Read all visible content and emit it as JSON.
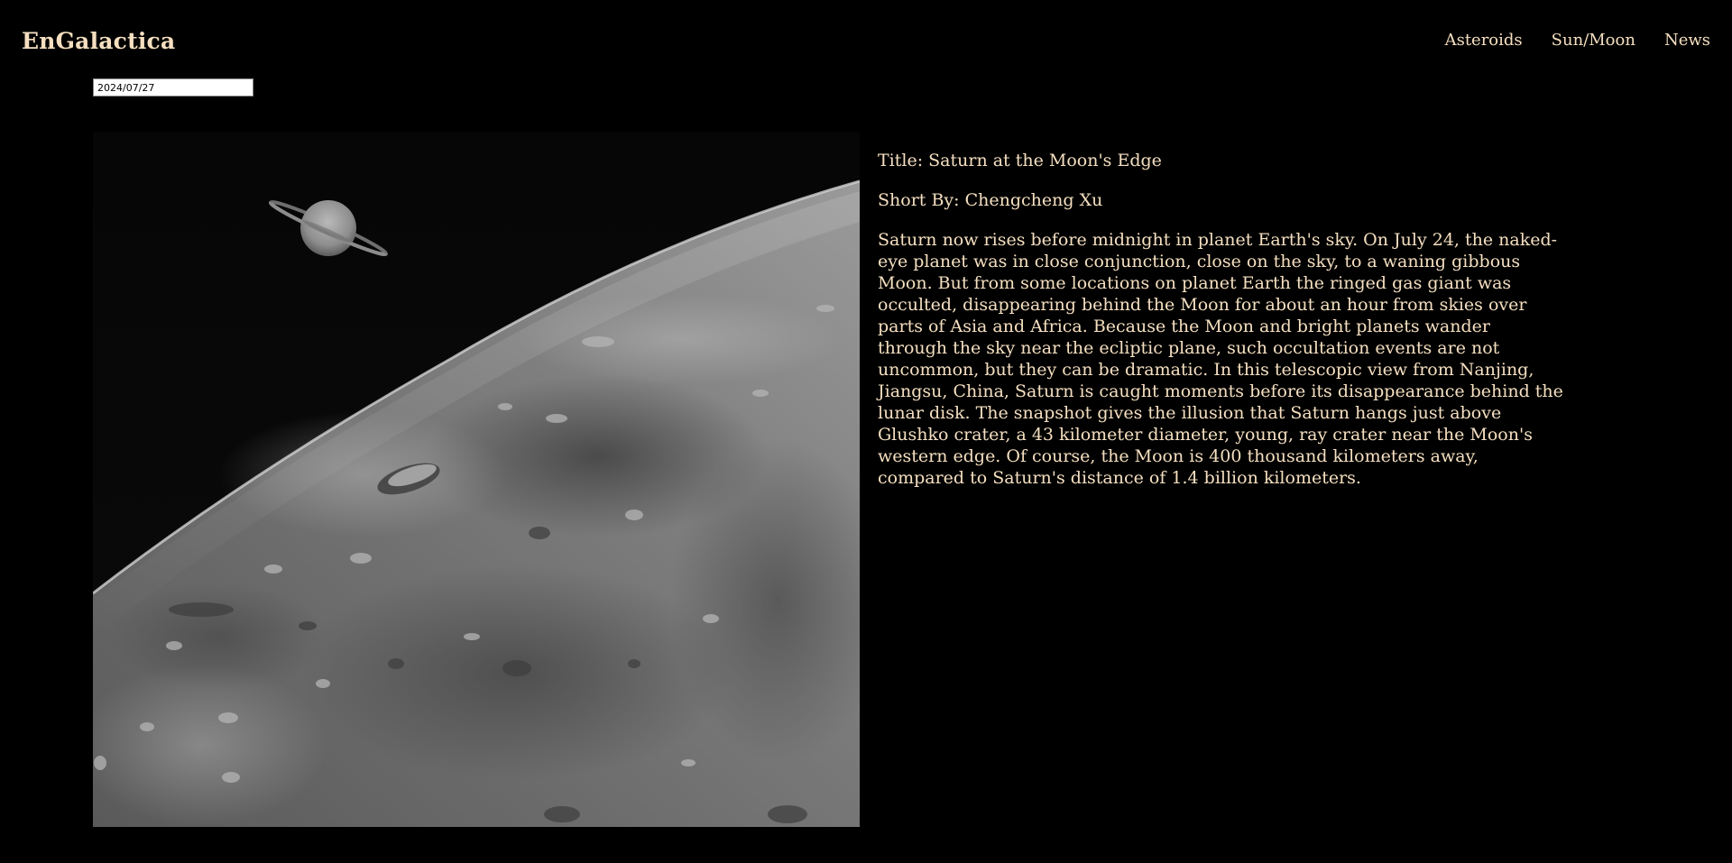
{
  "app": {
    "brand": "EnGalactica"
  },
  "nav": {
    "items": [
      {
        "label": "Asteroids"
      },
      {
        "label": "Sun/Moon"
      },
      {
        "label": "News"
      }
    ]
  },
  "date_picker": {
    "value": "2024/07/27"
  },
  "apod": {
    "title": "Title: Saturn at the Moon's Edge",
    "author": "Short By: Chengcheng Xu",
    "description": "Saturn now rises before midnight in planet Earth's sky. On July 24, the naked-eye planet was in close conjunction, close on the sky, to a waning gibbous Moon. But from some locations on planet Earth the ringed gas giant was occulted, disappearing behind the Moon for about an hour from skies over parts of Asia and Africa. Because the Moon and bright planets wander through the sky near the ecliptic plane, such occultation events are not uncommon, but they can be dramatic. In this telescopic view from Nanjing, Jiangsu, China, Saturn is caught moments before its disappearance behind the lunar disk. The snapshot gives the illusion that Saturn hangs just above Glushko crater, a 43 kilometer diameter, young, ray crater near the Moon's western edge. Of course, the Moon is 400 thousand kilometers away, compared to Saturn's distance of 1.4 billion kilometers."
  },
  "colors": {
    "background": "#000000",
    "text": "#f5dfc0"
  }
}
